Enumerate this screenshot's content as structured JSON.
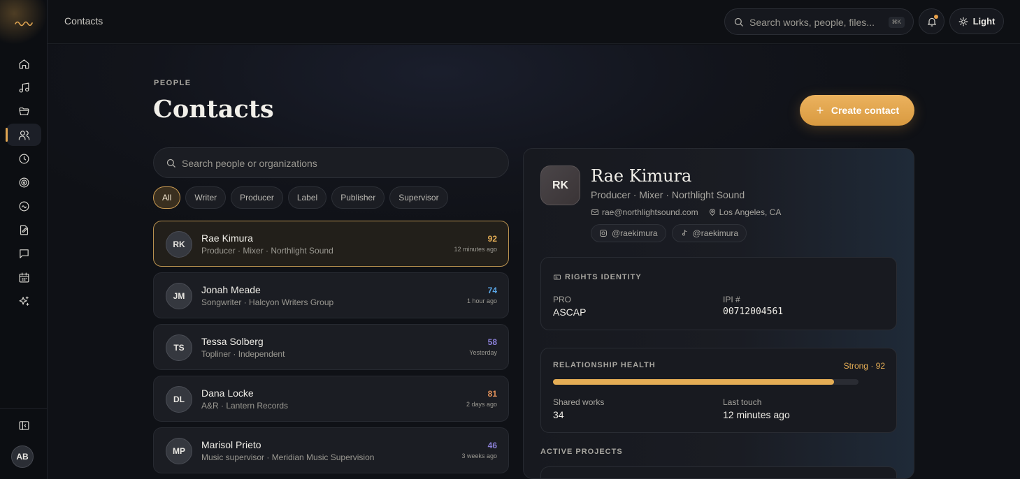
{
  "topbar": {
    "breadcrumb": "Contacts",
    "search_placeholder": "Search works, people, files...",
    "search_shortcut": "⌘K",
    "theme_label": "Light"
  },
  "user": {
    "initials": "AB"
  },
  "page": {
    "eyebrow": "PEOPLE",
    "title": "Contacts",
    "create_label": "Create contact",
    "search_placeholder": "Search people or organizations"
  },
  "filters": [
    "All",
    "Writer",
    "Producer",
    "Label",
    "Publisher",
    "Supervisor"
  ],
  "active_filter": "All",
  "contacts": [
    {
      "initials": "RK",
      "name": "Rae Kimura",
      "subtitle": "Producer · Mixer · Northlight Sound",
      "score": "92",
      "score_color": "#e4ad55",
      "when": "12 minutes ago"
    },
    {
      "initials": "JM",
      "name": "Jonah Meade",
      "subtitle": "Songwriter · Halcyon Writers Group",
      "score": "74",
      "score_color": "#5aa6e6",
      "when": "1 hour ago"
    },
    {
      "initials": "TS",
      "name": "Tessa Solberg",
      "subtitle": "Topliner · Independent",
      "score": "58",
      "score_color": "#8a7fd6",
      "when": "Yesterday"
    },
    {
      "initials": "DL",
      "name": "Dana Locke",
      "subtitle": "A&R · Lantern Records",
      "score": "81",
      "score_color": "#e0905a",
      "when": "2 days ago"
    },
    {
      "initials": "MP",
      "name": "Marisol Prieto",
      "subtitle": "Music supervisor · Meridian Music Supervision",
      "score": "46",
      "score_color": "#8a7fd6",
      "when": "3 weeks ago"
    }
  ],
  "detail": {
    "initials": "RK",
    "name": "Rae Kimura",
    "subtitle": "Producer · Mixer · Northlight Sound",
    "email": "rae@northlightsound.com",
    "location": "Los Angeles, CA",
    "instagram": "@raekimura",
    "tiktok": "@raekimura",
    "rights": {
      "heading": "RIGHTS IDENTITY",
      "pro_label": "PRO",
      "pro_value": "ASCAP",
      "ipi_label": "IPI #",
      "ipi_value": "00712004561"
    },
    "health": {
      "heading": "RELATIONSHIP HEALTH",
      "status": "Strong · 92",
      "level_percent": 92,
      "shared_label": "Shared works",
      "shared_value": "34",
      "last_label": "Last touch",
      "last_value": "12 minutes ago"
    },
    "projects_heading": "ACTIVE PROJECTS"
  },
  "colors": {
    "accent": "#e4ad55",
    "background": "#0f1116"
  }
}
